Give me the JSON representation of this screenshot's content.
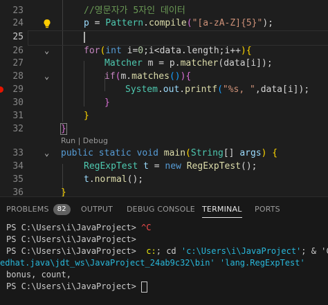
{
  "editor": {
    "line_numbers": [
      "23",
      "24",
      "25",
      "26",
      "27",
      "28",
      "29",
      "30",
      "31",
      "32",
      "33",
      "34",
      "35",
      "36"
    ],
    "line23": {
      "comment": "//영문자가 5자인 데이터"
    },
    "line24": {
      "var": "p",
      "eq": " = ",
      "cls": "Pattern",
      "dot": ".",
      "fn": "compile",
      "open": "(",
      "str": "\"[a-zA-Z]{5}\"",
      "close": ");"
    },
    "line26": {
      "kw": "for",
      "open": "(",
      "type": "int",
      "rest1": " i=",
      "zero": "0",
      "rest2": ";i<data.length;i++",
      "close": ")",
      "brace": "{"
    },
    "line27": {
      "type": "Matcher",
      "mid": " m = p.",
      "fn": "matcher",
      "args": "(data[i]);"
    },
    "line28": {
      "kw": "if",
      "open": "(",
      "obj": "m.",
      "fn": "matches",
      "call": "()",
      "close": ")",
      "brace": "{"
    },
    "line29": {
      "cls": "System",
      "dot1": ".",
      "field": "out",
      "dot2": ".",
      "fn": "printf",
      "open": "(",
      "str": "\"%s, \"",
      "rest": ",data[i]",
      "close": ");"
    },
    "line30": {
      "brace": "}"
    },
    "line31": {
      "brace": "}"
    },
    "line32": {
      "brace": "}"
    },
    "codelens": "Run | Debug",
    "line33": {
      "kw1": "public",
      "kw2": " static",
      "kw3": " void",
      "fn": " main",
      "open": "(",
      "type": "String",
      "arr": "[] ",
      "param": "args",
      "close": ")",
      "brace": " {"
    },
    "line34": {
      "type": "RegExpTest",
      "var": " t",
      "eq": " = ",
      "kw": "new",
      "cls": " RegExpTest",
      "call": "();"
    },
    "line35": {
      "var": "t",
      "dot": ".",
      "fn": "normal",
      "call": "();"
    },
    "line36": {
      "brace": "}"
    }
  },
  "panel": {
    "tabs": [
      "PROBLEMS",
      "OUTPUT",
      "DEBUG CONSOLE",
      "TERMINAL",
      "PORTS"
    ],
    "problems_count": "82",
    "active_tab": "TERMINAL"
  },
  "terminal": {
    "line1_prompt": "PS C:\\Users\\i\\JavaProject> ",
    "line1_ctrlc": "^C",
    "line2": "PS C:\\Users\\i\\JavaProject>",
    "line3_prompt": "PS C:\\Users\\i\\JavaProject>  ",
    "line3_cmd": "c:",
    "line3_mid": "; cd ",
    "line3_path": "'c:\\Users\\i\\JavaProject'",
    "line3_rest": "; & 'C:",
    "line4_a": "edhat.java\\jdt_ws\\JavaProject_24ab9c32\\bin' ",
    "line4_b": "'lang.RegExpTest'",
    "line5": "bonus, count,",
    "line6_prompt": "PS C:\\Users\\i\\JavaProject> "
  },
  "colors": {
    "editor_bg": "#1e1e1e",
    "panel_bg": "#181818",
    "keyword": "#569cd6",
    "control": "#c586c0",
    "type": "#4ec9b0",
    "function": "#dcdcaa",
    "string": "#ce9178",
    "comment": "#6a9955"
  },
  "icons": {
    "gutter_hint": "lightbulb-icon",
    "breakpoint": "breakpoint-icon"
  }
}
